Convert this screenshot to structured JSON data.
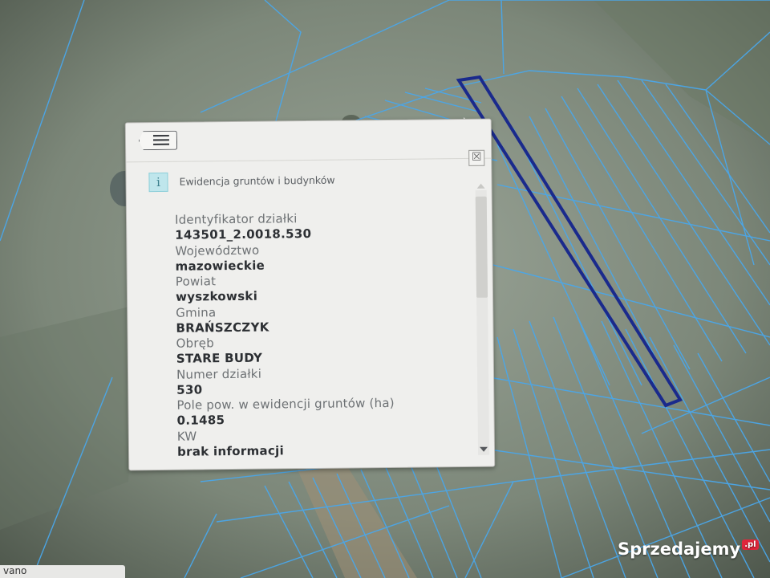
{
  "popup": {
    "layer_title": "Ewidencja gruntów i budynków",
    "fields": [
      {
        "label": "Identyfikator działki",
        "value": "143501_2.0018.530"
      },
      {
        "label": "Województwo",
        "value": "mazowieckie"
      },
      {
        "label": "Powiat",
        "value": "wyszkowski"
      },
      {
        "label": "Gmina",
        "value": "BRAŃSZCZYK"
      },
      {
        "label": "Obręb",
        "value": "STARE BUDY"
      },
      {
        "label": "Numer działki",
        "value": "530"
      },
      {
        "label": "Pole pow. w ewidencji gruntów (ha)",
        "value": "0.1485"
      },
      {
        "label": "KW",
        "value": "brak informacji"
      }
    ],
    "close_glyph": "☒",
    "info_glyph": "i"
  },
  "corner": {
    "text": "vano"
  },
  "watermark": {
    "text": "Sprzedajemy",
    "badge": ".pl"
  },
  "colors": {
    "parcel_lines": "#4aa7ea",
    "selected_parcel": "#1a2a8c",
    "popup_bg": "#efefed"
  },
  "icons": [
    "list-back-icon",
    "close-icon",
    "info-icon",
    "scroll-up-icon",
    "scroll-down-icon"
  ]
}
